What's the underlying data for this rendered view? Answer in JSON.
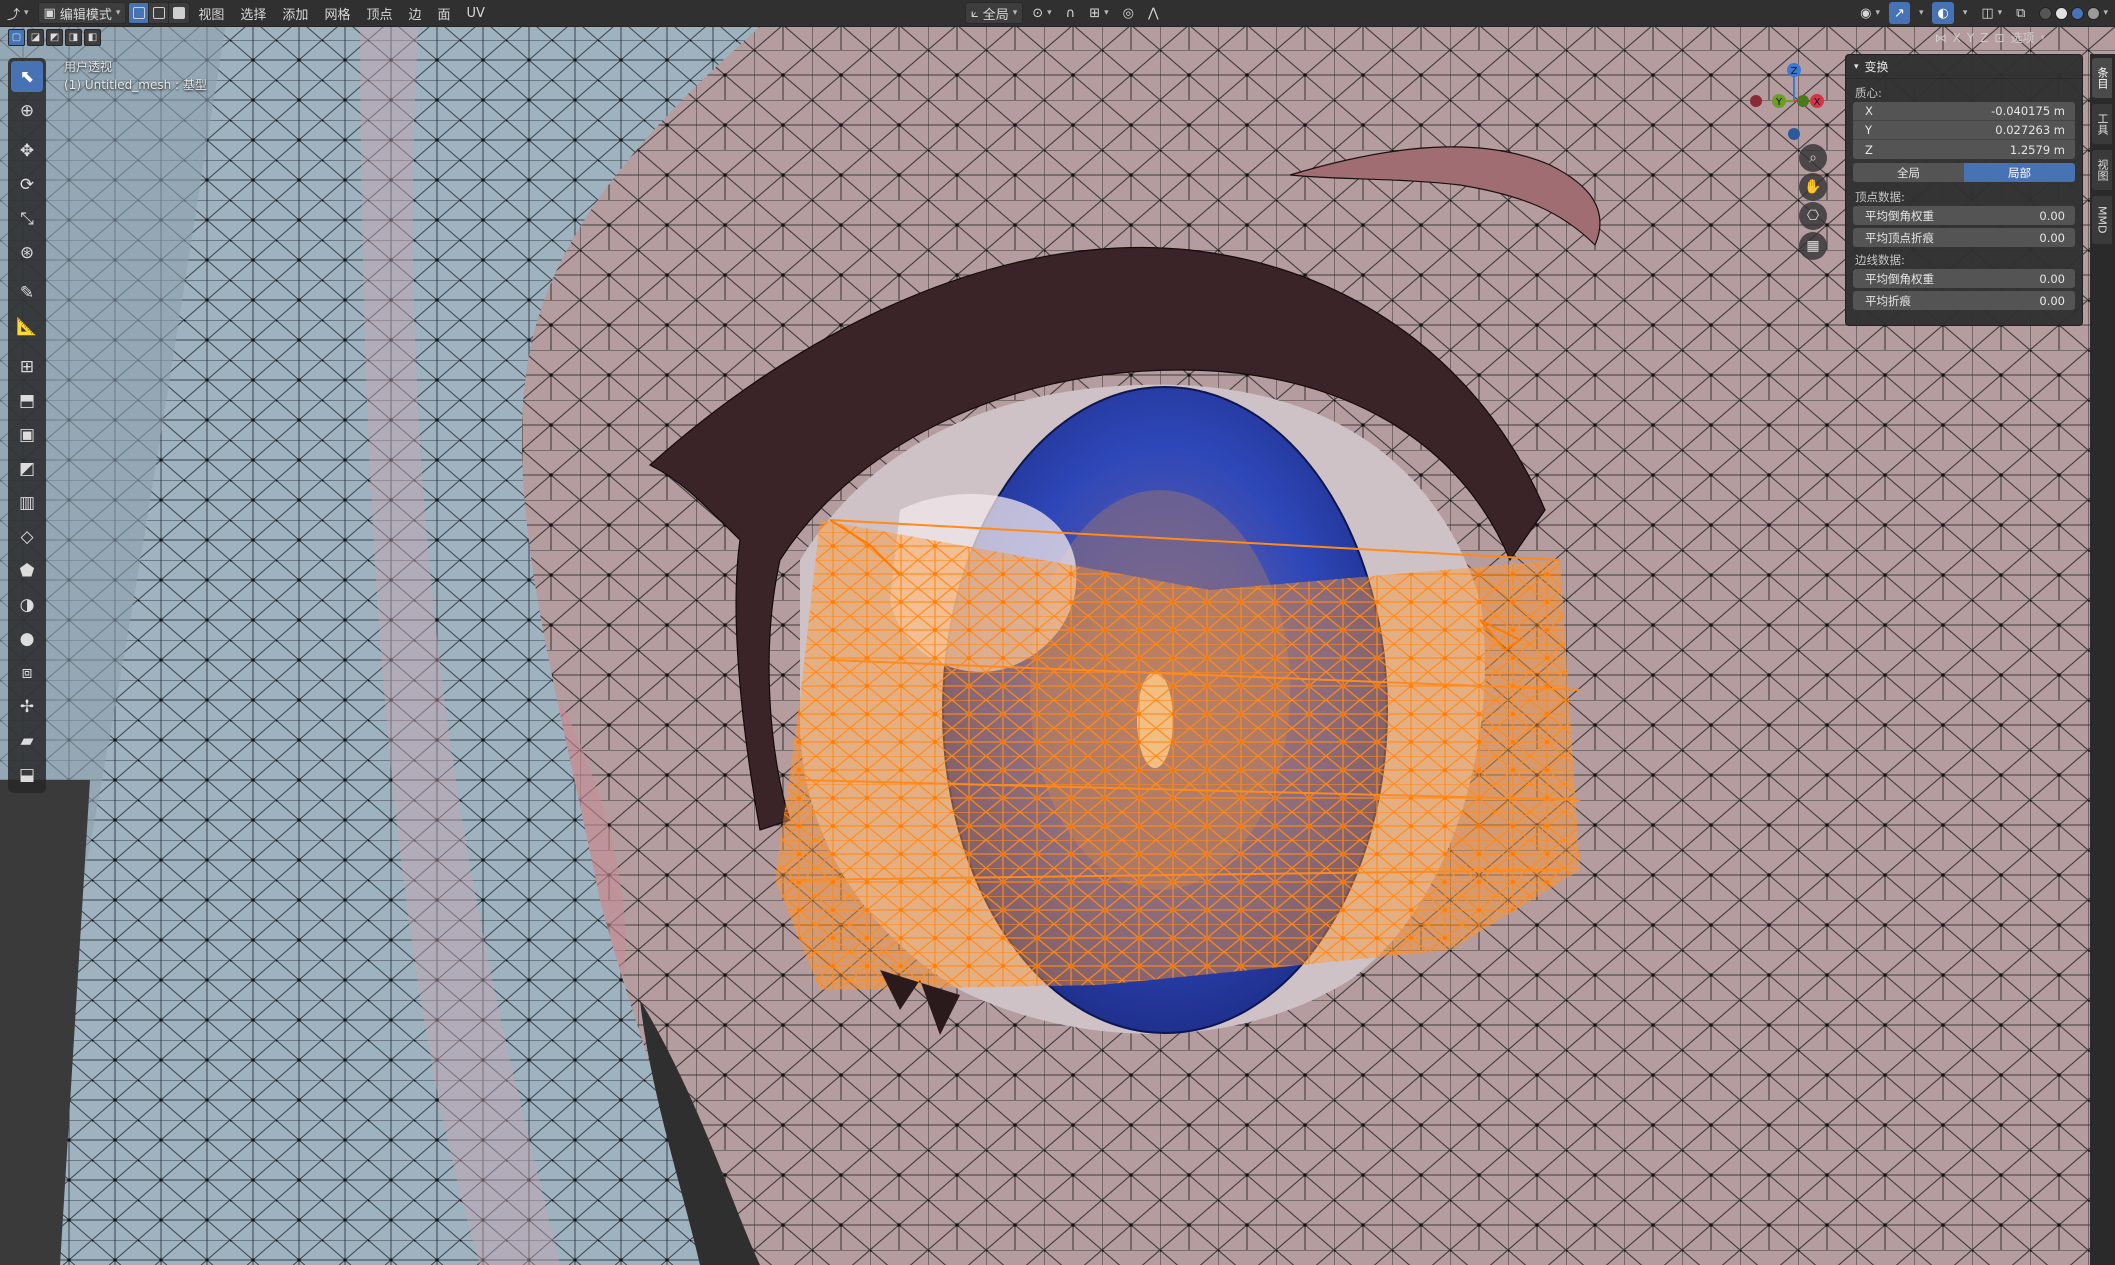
{
  "topbar": {
    "mode_label": "编辑模式",
    "menus": [
      "视图",
      "选择",
      "添加",
      "网格",
      "顶点",
      "边",
      "面",
      "UV"
    ],
    "pivot_label": "全局",
    "overlays_label": "选项"
  },
  "axis_lock": {
    "x": "X",
    "y": "Y",
    "z": "Z"
  },
  "viewport": {
    "view_name": "用户透视",
    "object_info": "(1) Untitled_mesh : 基型"
  },
  "gizmo": {
    "x": "X",
    "y": "Y",
    "z": "Z",
    "x_color": "#d6344b",
    "y_color": "#6a9e28",
    "z_color": "#3a7ad2"
  },
  "npanel": {
    "section_title": "变换",
    "median_label": "质心:",
    "median": [
      {
        "axis": "X",
        "value": "-0.040175 m"
      },
      {
        "axis": "Y",
        "value": "0.027263 m"
      },
      {
        "axis": "Z",
        "value": "1.2579 m"
      }
    ],
    "space_global": "全局",
    "space_local": "局部",
    "vertex_data_label": "顶点数据:",
    "vertex_bevel_label": "平均倒角权重",
    "vertex_bevel_value": "0.00",
    "vertex_crease_label": "平均顶点折痕",
    "vertex_crease_value": "0.00",
    "edge_data_label": "边线数据:",
    "edge_bevel_label": "平均倒角权重",
    "edge_bevel_value": "0.00",
    "edge_crease_label": "平均折痕",
    "edge_crease_value": "0.00"
  },
  "sidetabs": [
    "条目",
    "工具",
    "视图",
    "MMD"
  ],
  "colors": {
    "accent": "#4772b3",
    "selection": "#ff8a1c",
    "skin": "#b59c9e",
    "hair": "#9eb2c0",
    "iris": "#243a9c"
  }
}
